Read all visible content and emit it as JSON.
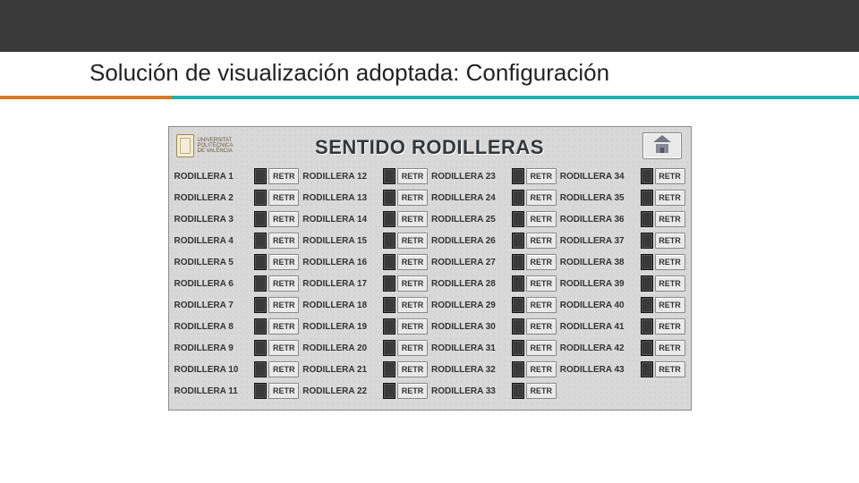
{
  "slide": {
    "title": "Solución de visualización adoptada: Configuración"
  },
  "hmi": {
    "logo_text": "UNIVERSITAT\nPOLITÈCNICA\nDE VALÈNCIA",
    "title": "SENTIDO RODILLERAS",
    "button_label": "RETR",
    "columns": [
      {
        "rows": [
          1,
          2,
          3,
          4,
          5,
          6,
          7,
          8,
          9,
          10,
          11
        ]
      },
      {
        "rows": [
          12,
          13,
          14,
          15,
          16,
          17,
          18,
          19,
          20,
          21,
          22
        ]
      },
      {
        "rows": [
          23,
          24,
          25,
          26,
          27,
          28,
          29,
          30,
          31,
          32,
          33
        ]
      },
      {
        "rows": [
          34,
          35,
          36,
          37,
          38,
          39,
          40,
          41,
          42,
          43
        ]
      }
    ],
    "row_label_prefix": "RODILLERA "
  }
}
